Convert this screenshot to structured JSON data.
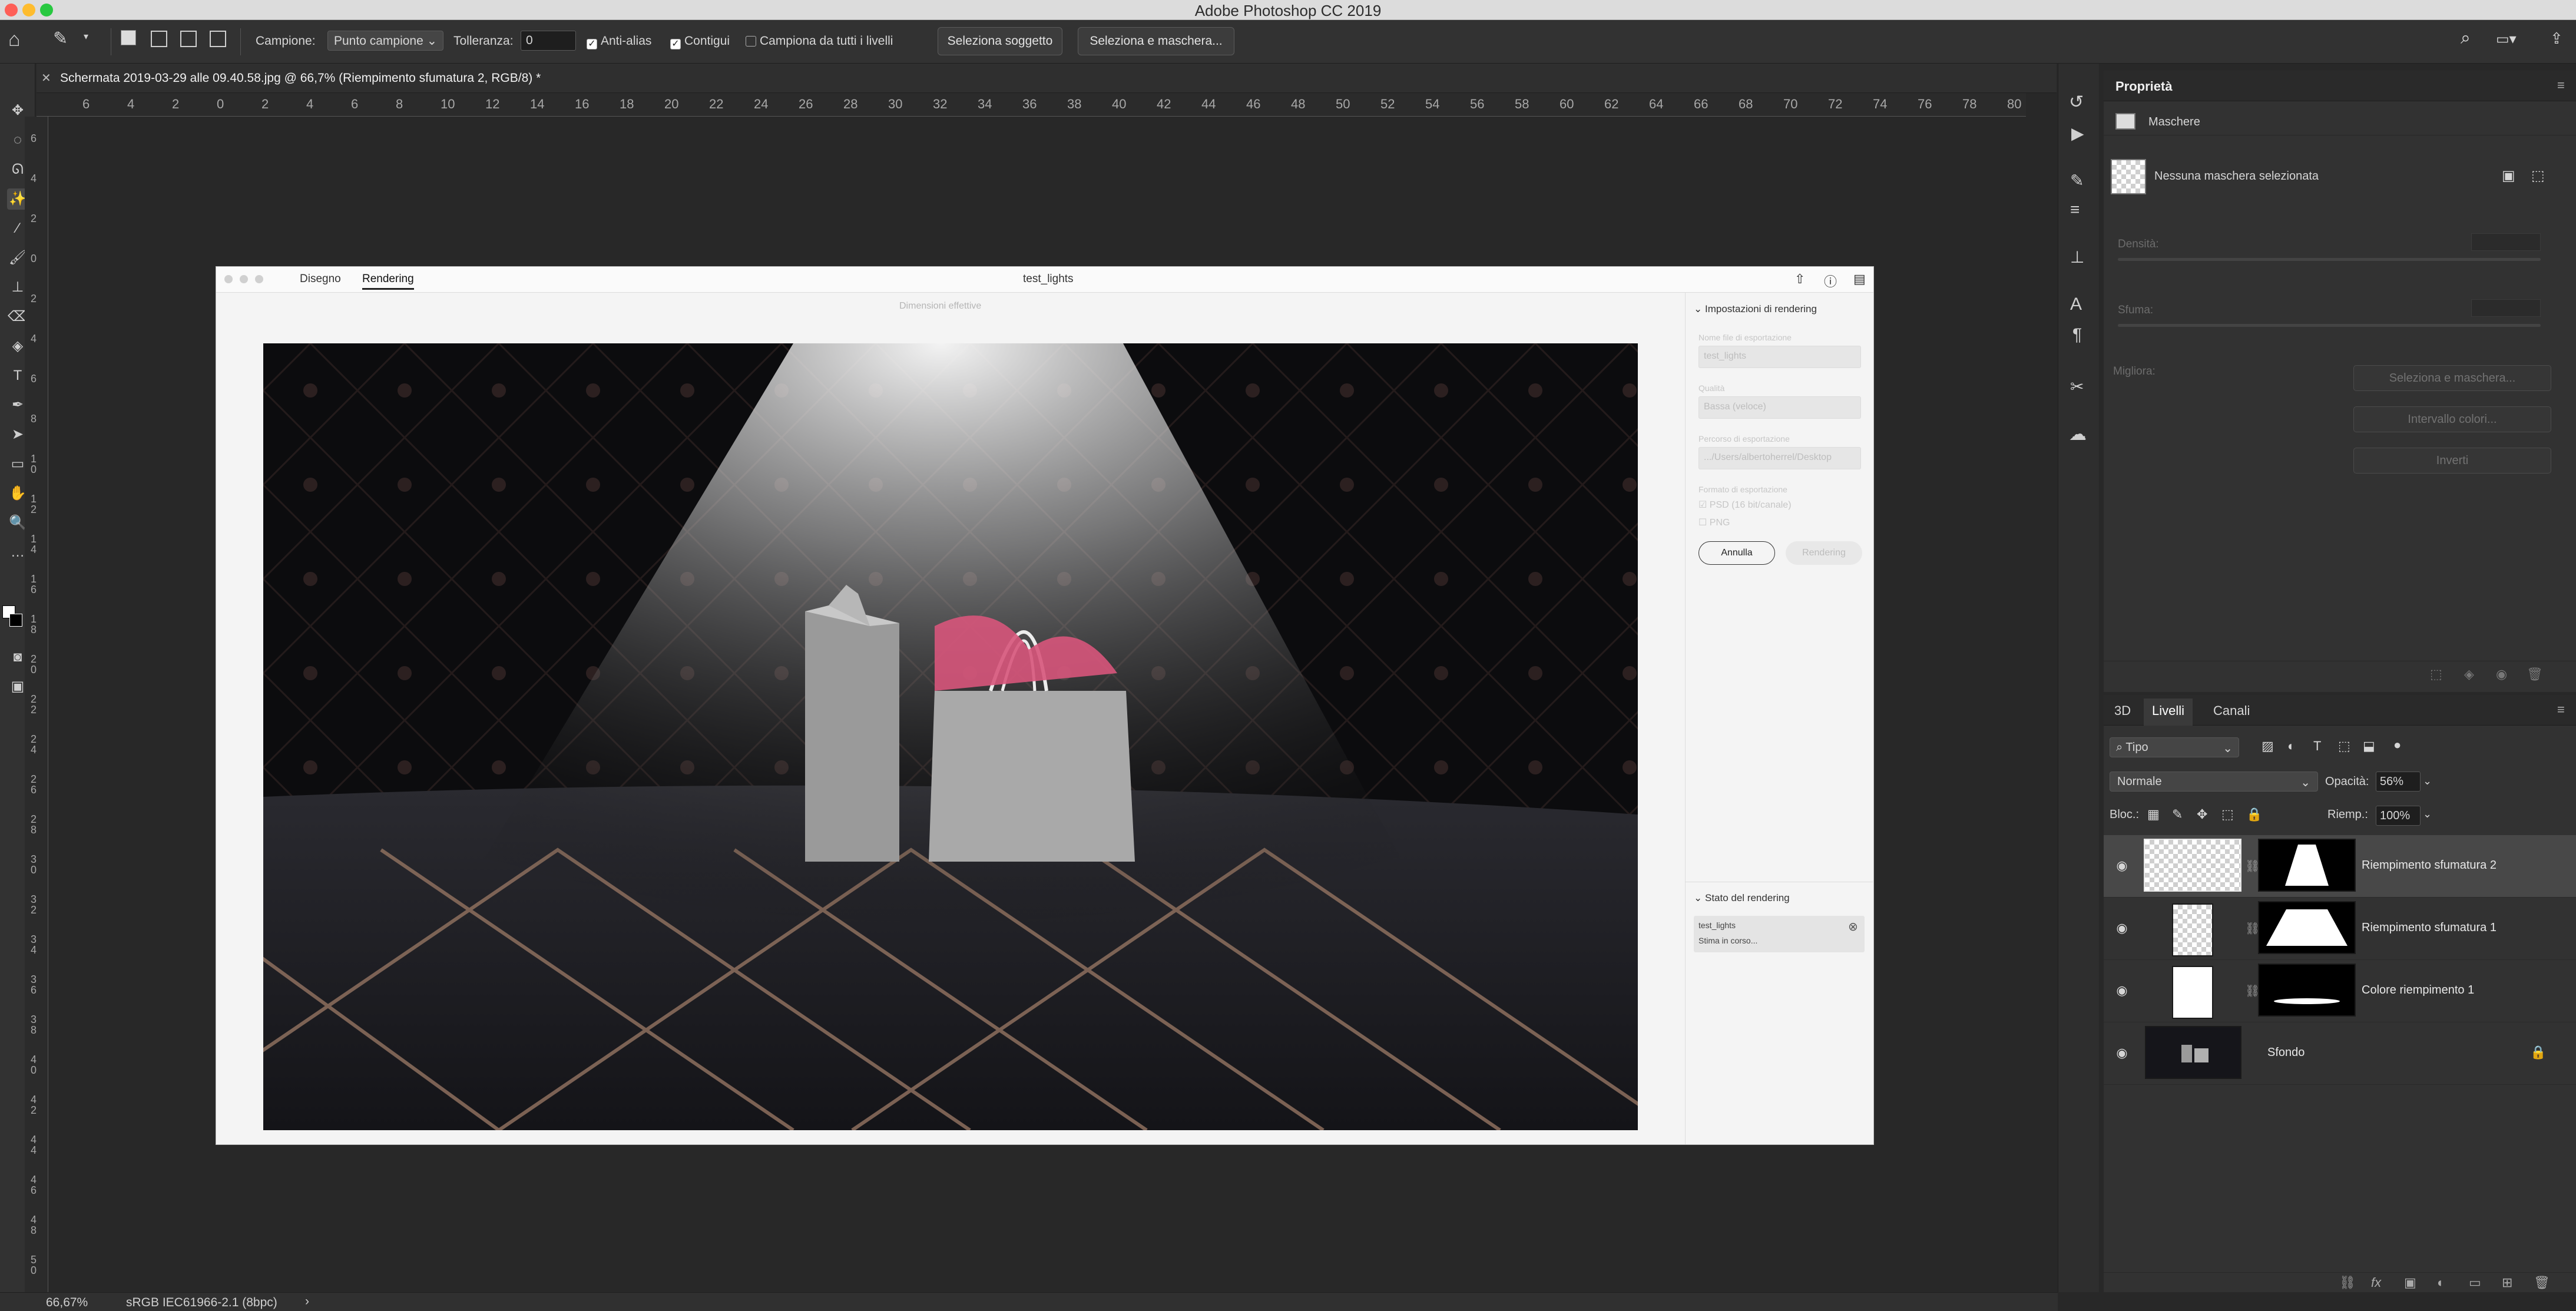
{
  "app_title": "Adobe Photoshop CC 2019",
  "options": {
    "sample_label": "Campione:",
    "sample_value": "Punto campione",
    "tolerance_label": "Tolleranza:",
    "tolerance_value": "0",
    "antialias": "Anti-alias",
    "contiguous": "Contigui",
    "all_layers": "Campiona da tutti i livelli",
    "select_subject": "Seleziona soggetto",
    "select_mask": "Seleziona e maschera..."
  },
  "document": {
    "tab_title": "Schermata 2019-03-29 alle 09.40.58.jpg @ 66,7% (Riempimento sfumatura 2, RGB/8) *"
  },
  "hruler": [
    "6",
    "4",
    "2",
    "0",
    "2",
    "4",
    "6",
    "8",
    "10",
    "12",
    "14",
    "16",
    "18",
    "20",
    "22",
    "24",
    "26",
    "28",
    "30",
    "32",
    "34",
    "36",
    "38",
    "40",
    "42",
    "44",
    "46",
    "48",
    "50",
    "52",
    "54",
    "56",
    "58",
    "60",
    "62",
    "64",
    "66",
    "68",
    "70",
    "72",
    "74",
    "76",
    "78",
    "80"
  ],
  "vruler": [
    "6",
    "4",
    "2",
    "0",
    "2",
    "4",
    "6",
    "8",
    "1 0",
    "1 2",
    "1 4",
    "1 6",
    "1 8",
    "2 0",
    "2 2",
    "2 4",
    "2 6",
    "2 8",
    "3 0",
    "3 2",
    "3 4",
    "3 6",
    "3 8",
    "4 0",
    "4 2",
    "4 4",
    "4 6",
    "4 8",
    "5 0"
  ],
  "dialog": {
    "tab_draw": "Disegno",
    "tab_render": "Rendering",
    "title": "test_lights",
    "dims": "Dimensioni effettive",
    "settings_title": "Impostazioni di rendering",
    "export_name_label": "Nome file di esportazione",
    "export_name": "test_lights",
    "quality_label": "Qualità",
    "quality": "Bassa (veloce)",
    "path_label": "Percorso di esportazione",
    "path": ".../Users/albertoherrel/Desktop",
    "format_label": "Formato di esportazione",
    "psd": "PSD (16 bit/canale)",
    "png": "PNG",
    "cancel": "Annulla",
    "render": "Rendering",
    "status_title": "Stato del rendering",
    "status_file": "test_lights",
    "status_text": "Stima in corso..."
  },
  "properties": {
    "title": "Proprietà",
    "masks": "Maschere",
    "no_mask": "Nessuna maschera selezionata",
    "density": "Densità:",
    "feather": "Sfuma:",
    "refine": "Migliora:",
    "btn_select_mask": "Seleziona e maschera...",
    "btn_color_range": "Intervallo colori...",
    "btn_invert": "Inverti"
  },
  "layers_panel": {
    "tabs": [
      "3D",
      "Livelli",
      "Canali"
    ],
    "filter": "Tipo",
    "blend": "Normale",
    "opacity_label": "Opacità:",
    "opacity": "56%",
    "lock_label": "Bloc.:",
    "fill_label": "Riemp.:",
    "fill": "100%",
    "layers": [
      {
        "name": "Riempimento sfumatura 2",
        "selected": true
      },
      {
        "name": "Riempimento sfumatura 1",
        "selected": false
      },
      {
        "name": "Colore riempimento 1",
        "selected": false
      },
      {
        "name": "Sfondo",
        "selected": false
      }
    ]
  },
  "status": {
    "zoom": "66,67%",
    "profile": "sRGB IEC61966-2.1 (8bpc)"
  }
}
